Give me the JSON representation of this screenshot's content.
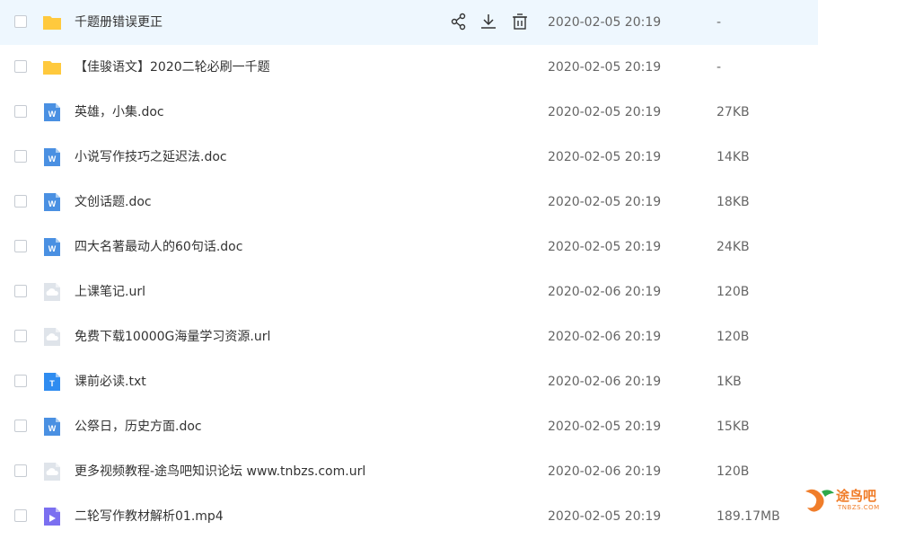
{
  "files": [
    {
      "name": "千题册错误更正",
      "date": "2020-02-05 20:19",
      "size": "-",
      "type": "folder"
    },
    {
      "name": "【佳骏语文】2020二轮必刷一千题",
      "date": "2020-02-05 20:19",
      "size": "-",
      "type": "folder"
    },
    {
      "name": "英雄，小集.doc",
      "date": "2020-02-05 20:19",
      "size": "27KB",
      "type": "word"
    },
    {
      "name": "小说写作技巧之延迟法.doc",
      "date": "2020-02-05 20:19",
      "size": "14KB",
      "type": "word"
    },
    {
      "name": "文创话题.doc",
      "date": "2020-02-05 20:19",
      "size": "18KB",
      "type": "word"
    },
    {
      "name": "四大名著最动人的60句话.doc",
      "date": "2020-02-05 20:19",
      "size": "24KB",
      "type": "word"
    },
    {
      "name": "上课笔记.url",
      "date": "2020-02-06 20:19",
      "size": "120B",
      "type": "url"
    },
    {
      "name": "免费下载10000G海量学习资源.url",
      "date": "2020-02-06 20:19",
      "size": "120B",
      "type": "url"
    },
    {
      "name": "课前必读.txt",
      "date": "2020-02-06 20:19",
      "size": "1KB",
      "type": "txt"
    },
    {
      "name": "公祭日，历史方面.doc",
      "date": "2020-02-05 20:19",
      "size": "15KB",
      "type": "word"
    },
    {
      "name": "更多视频教程-途鸟吧知识论坛 www.tnbzs.com.url",
      "date": "2020-02-06 20:19",
      "size": "120B",
      "type": "url"
    },
    {
      "name": "二轮写作教材解析01.mp4",
      "date": "2020-02-05 20:19",
      "size": "189.17MB",
      "type": "video"
    }
  ],
  "row_actions": {
    "share_icon": "share-icon",
    "download_icon": "download-icon",
    "delete_icon": "delete-icon"
  },
  "colors": {
    "hover_row": "#eef7fe",
    "folder": "#ffc93d",
    "word": "#4a90e2",
    "txt": "#2f8cf0",
    "url": "#dfe4ea",
    "video": "#7b6ff0",
    "watermark": "#f07d2a"
  },
  "watermark": {
    "text": "途鸟吧",
    "sub": "TNBZS.COM"
  }
}
